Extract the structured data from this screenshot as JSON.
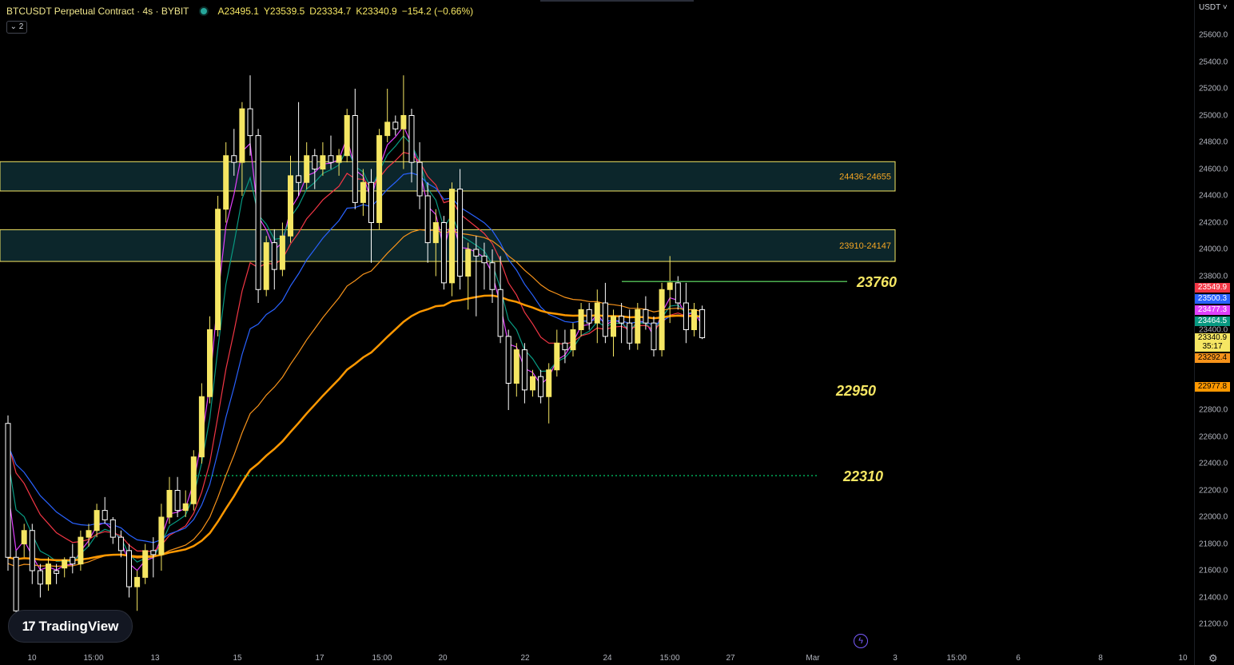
{
  "header": {
    "symbol": "BTCUSDT Perpetual Contract · 4s · BYBIT",
    "open": "A23495.1",
    "high": "Y23539.5",
    "low": "D23334.7",
    "close": "K23340.9",
    "change": "−154.2 (−0.66%)",
    "collapse_label": "⌄ 2"
  },
  "price_axis": {
    "currency": "USDT ˅",
    "ticks": [
      "25600.0",
      "25400.0",
      "25200.0",
      "25000.0",
      "24800.0",
      "24600.0",
      "24400.0",
      "24200.0",
      "24000.0",
      "23800.0",
      "23400.0",
      "22800.0",
      "22600.0",
      "22400.0",
      "22200.0",
      "22000.0",
      "21800.0",
      "21600.0",
      "21400.0",
      "21200.0"
    ],
    "tags": [
      {
        "text": "23549.9",
        "color": "#f23645",
        "text_color": "#ffffff",
        "value": 23549.9
      },
      {
        "text": "23500.3",
        "color": "#2962ff",
        "text_color": "#ffffff",
        "value": 23500.3
      },
      {
        "text": "23477.3",
        "color": "#e040fb",
        "text_color": "#ffffff",
        "value": 23477.3
      },
      {
        "text": "23464.5",
        "color": "#089981",
        "text_color": "#ffffff",
        "value": 23464.5
      },
      {
        "text": "23340.9",
        "color": "#f5e663",
        "text_color": "#000000",
        "value": 23340.9
      },
      {
        "text": "35:17",
        "color": "#f5e663",
        "text_color": "#000000",
        "value": 23274
      },
      {
        "text": "23292.4",
        "color": "#f7931a",
        "text_color": "#000000",
        "value": 23292.4
      },
      {
        "text": "22977.8",
        "color": "#ff9800",
        "text_color": "#000000",
        "value": 22977.8
      }
    ]
  },
  "time_axis": [
    "10",
    "15:00",
    "13",
    "15",
    "17",
    "15:00",
    "20",
    "22",
    "24",
    "15:00",
    "27",
    "Mar",
    "3",
    "15:00",
    "6",
    "8",
    "10"
  ],
  "logo": "TradingView",
  "settings_icon": "gear-icon",
  "chart_data": {
    "type": "candlestick",
    "title": "BTCUSDT Perpetual Contract · 4s · BYBIT",
    "ylim": [
      21100,
      25750
    ],
    "xlim": [
      0,
      82
    ],
    "grid": false,
    "colors": {
      "up": "#f5e663",
      "down": "#ffffff",
      "background": "#000000",
      "zone_fill": "#0d2a30",
      "zone_border": "#f5e663"
    },
    "candles": [
      [
        21,
        22700,
        22760,
        21600,
        21700
      ],
      [
        22,
        21700,
        21750,
        21200,
        21300
      ],
      [
        23,
        21800,
        21950,
        21700,
        21900
      ],
      [
        24,
        21900,
        21950,
        21500,
        21600
      ],
      [
        25,
        21600,
        21650,
        21400,
        21500
      ],
      [
        26,
        21500,
        21700,
        21450,
        21650
      ],
      [
        27,
        21600,
        21650,
        21500,
        21580
      ],
      [
        28,
        21620,
        21700,
        21550,
        21680
      ],
      [
        29,
        21700,
        21800,
        21580,
        21650
      ],
      [
        30,
        21650,
        21900,
        21600,
        21850
      ],
      [
        31,
        21850,
        21950,
        21780,
        21900
      ],
      [
        32,
        21900,
        22100,
        21850,
        22050
      ],
      [
        33,
        22050,
        22150,
        21950,
        21980
      ],
      [
        34,
        21980,
        22000,
        21800,
        21850
      ],
      [
        35,
        21850,
        21900,
        21700,
        21750
      ],
      [
        36,
        21750,
        21800,
        21400,
        21480
      ],
      [
        37,
        21480,
        21600,
        21300,
        21550
      ],
      [
        38,
        21550,
        21800,
        21500,
        21750
      ],
      [
        39,
        21750,
        21850,
        21550,
        21720
      ],
      [
        40,
        21720,
        22100,
        21600,
        22000
      ],
      [
        41,
        22000,
        22300,
        21950,
        22200
      ],
      [
        42,
        22200,
        22300,
        22000,
        22050
      ],
      [
        43,
        22050,
        22200,
        22000,
        22100
      ],
      [
        44,
        22100,
        22500,
        22050,
        22450
      ],
      [
        45,
        22450,
        23000,
        22400,
        22900
      ],
      [
        46,
        22900,
        23500,
        22850,
        23400
      ],
      [
        47,
        23400,
        24400,
        23350,
        24300
      ],
      [
        48,
        24300,
        24800,
        24200,
        24700
      ],
      [
        49,
        24700,
        24900,
        24550,
        24650
      ],
      [
        50,
        24650,
        25100,
        24400,
        25050
      ],
      [
        51,
        25050,
        25300,
        24700,
        24850
      ],
      [
        52,
        24850,
        24900,
        23600,
        23700
      ],
      [
        53,
        23700,
        24100,
        23650,
        24050
      ],
      [
        54,
        24050,
        24150,
        23700,
        23850
      ],
      [
        55,
        23850,
        24200,
        23800,
        24100
      ],
      [
        56,
        24100,
        24700,
        24050,
        24550
      ],
      [
        57,
        24550,
        25100,
        24400,
        24500
      ],
      [
        58,
        24500,
        24800,
        24450,
        24700
      ],
      [
        59,
        24700,
        24750,
        24450,
        24600
      ],
      [
        60,
        24600,
        24800,
        24550,
        24700
      ],
      [
        61,
        24700,
        24850,
        24600,
        24650
      ],
      [
        62,
        24650,
        24750,
        24550,
        24700
      ],
      [
        63,
        24700,
        25050,
        24650,
        25000
      ],
      [
        64,
        25000,
        25200,
        24300,
        24350
      ],
      [
        65,
        24350,
        24600,
        24250,
        24500
      ],
      [
        66,
        24500,
        24600,
        23900,
        24200
      ],
      [
        67,
        24200,
        24900,
        24150,
        24850
      ],
      [
        68,
        24850,
        25200,
        24800,
        24950
      ],
      [
        69,
        24950,
        25000,
        24850,
        24900
      ],
      [
        70,
        24900,
        25300,
        24600,
        25000
      ],
      [
        71,
        25000,
        25050,
        24500,
        24650
      ],
      [
        72,
        24650,
        24800,
        24300,
        24400
      ],
      [
        73,
        24400,
        24500,
        23900,
        24050
      ],
      [
        74,
        24050,
        24300,
        23800,
        24200
      ],
      [
        75,
        24200,
        24250,
        23700,
        23750
      ],
      [
        76,
        23750,
        24500,
        23650,
        24450
      ],
      [
        77,
        24450,
        24600,
        23700,
        23800
      ],
      [
        78,
        23800,
        24050,
        23550,
        24000
      ],
      [
        79,
        24000,
        24100,
        23500,
        23950
      ],
      [
        80,
        23950,
        24050,
        23700,
        23900
      ],
      [
        81,
        23900,
        24000,
        23600,
        23700
      ],
      [
        82,
        23700,
        23950,
        23300,
        23350
      ],
      [
        83,
        23350,
        23400,
        22800,
        23000
      ],
      [
        84,
        23000,
        23300,
        22900,
        23250
      ],
      [
        85,
        23250,
        23300,
        22850,
        22950
      ],
      [
        86,
        22950,
        23100,
        22900,
        23050
      ],
      [
        87,
        23050,
        23100,
        22850,
        22900
      ],
      [
        88,
        22900,
        23150,
        22700,
        23100
      ],
      [
        89,
        23100,
        23400,
        23050,
        23300
      ],
      [
        90,
        23300,
        23400,
        23150,
        23250
      ],
      [
        91,
        23250,
        23450,
        23200,
        23400
      ],
      [
        92,
        23400,
        23600,
        23350,
        23550
      ],
      [
        93,
        23550,
        23600,
        23400,
        23450
      ],
      [
        94,
        23450,
        23700,
        23300,
        23600
      ],
      [
        95,
        23600,
        23750,
        23300,
        23350
      ],
      [
        96,
        23350,
        23550,
        23200,
        23500
      ],
      [
        97,
        23500,
        23600,
        23300,
        23450
      ],
      [
        98,
        23450,
        23550,
        23250,
        23300
      ],
      [
        99,
        23300,
        23600,
        23250,
        23550
      ],
      [
        100,
        23550,
        23650,
        23400,
        23450
      ],
      [
        101,
        23450,
        23500,
        23200,
        23250
      ],
      [
        102,
        23250,
        23750,
        23200,
        23700
      ],
      [
        103,
        23700,
        23950,
        23450,
        23750
      ],
      [
        104,
        23750,
        23800,
        23550,
        23600
      ],
      [
        105,
        23600,
        23750,
        23300,
        23400
      ],
      [
        106,
        23400,
        23600,
        23350,
        23550
      ],
      [
        107,
        23550,
        23580,
        23330,
        23340
      ]
    ],
    "zones": [
      {
        "label": "24436-24655",
        "low": 24436,
        "high": 24655
      },
      {
        "label": "23910-24147",
        "low": 23910,
        "high": 24147
      }
    ],
    "levels": [
      {
        "label": "23760",
        "value": 23760,
        "color": "#4caf50",
        "style": "solid",
        "label_color": "#f5e663"
      },
      {
        "label": "22950",
        "value": 22950,
        "color": "#ff9800",
        "style": "curve",
        "label_color": "#f5e663"
      },
      {
        "label": "22310",
        "value": 22310,
        "color": "#00e676",
        "style": "dotted",
        "label_color": "#f5e663"
      }
    ],
    "moving_averages": [
      {
        "color": "#e040fb",
        "last": 23477.3
      },
      {
        "color": "#089981",
        "last": 23464.5
      },
      {
        "color": "#f23645",
        "last": 23549.9
      },
      {
        "color": "#2962ff",
        "last": 23500.3
      },
      {
        "color": "#f7931a",
        "last": 23292.4
      },
      {
        "color": "#ff9800",
        "last": 22977.8
      }
    ]
  }
}
